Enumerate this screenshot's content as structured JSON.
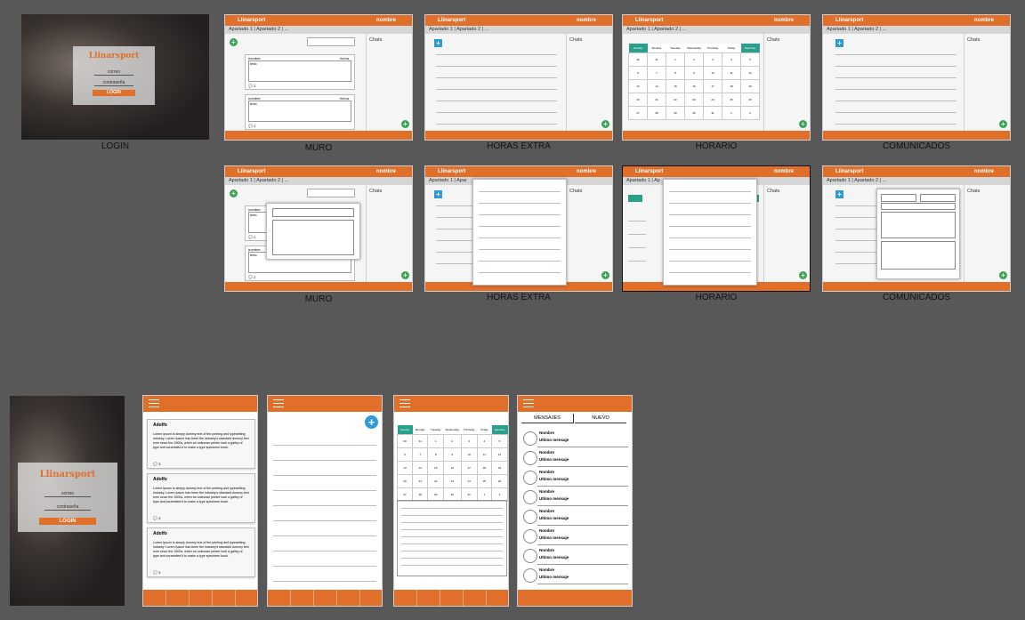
{
  "brand": "Llinarsport",
  "user_name": "nombre",
  "breadcrumb": "Apartado 1 | Apartado 2 | ...",
  "breadcrumb_cut": "Apartado 1 | Apar",
  "breadcrumb_cut2": "Apartado 1 | Ap",
  "chats_label": "Chats",
  "login": {
    "user_field": "correo",
    "password_field": "contraseña",
    "button": "LOGIN"
  },
  "captions": {
    "login": "LOGIN",
    "muro": "MURO",
    "horas_extra": "HORAS EXTRA",
    "horario": "HORARIO",
    "comunicados": "COMUNICADOS"
  },
  "post": {
    "author_label": "nombre",
    "date_label": "fecha",
    "body_label": "texto",
    "comments": "2"
  },
  "calendar": {
    "weekdays": [
      "Sunday",
      "Monday",
      "Tuesday",
      "Wednesday",
      "Thursday",
      "Friday",
      "Saturday"
    ],
    "rows": [
      [
        "30",
        "31",
        "1",
        "2",
        "3",
        "4",
        "5"
      ],
      [
        "6",
        "7",
        "8",
        "9",
        "10",
        "11",
        "12"
      ],
      [
        "13",
        "14",
        "15",
        "16",
        "17",
        "18",
        "19"
      ],
      [
        "20",
        "21",
        "22",
        "23",
        "24",
        "25",
        "26"
      ],
      [
        "27",
        "28",
        "29",
        "30",
        "31",
        "1",
        "2"
      ]
    ]
  },
  "mobile_posts": [
    {
      "author": "Adolfo",
      "text": "Lorem Ipsum is simply dummy text of the printing and typesetting industry. Lorem Ipsum has been the industry's standard dummy text ever since the 1500s, when an unknown printer took a galley of type and scrambled it to make a type specimen book.",
      "comments": "3"
    },
    {
      "author": "Adolfo",
      "text": "Lorem Ipsum is simply dummy text of the printing and typesetting industry. Lorem Ipsum has been the industry's standard dummy text ever since the 1500s, when an unknown printer took a galley of type and scrambled it to make a type specimen book.",
      "comments": "3"
    },
    {
      "author": "Adolfo",
      "text": "Lorem Ipsum is simply dummy text of the printing and typesetting industry. Lorem Ipsum has been the industry's standard dummy text ever since the 1500s, when an unknown printer took a galley of type and scrambled it to make a type specimen book.",
      "comments": "3"
    }
  ],
  "messages_tabs": {
    "left": "MENSAJES",
    "right": "NUEVO"
  },
  "chat_item": {
    "name": "Nombre",
    "last": "Ultimo mensaje"
  },
  "colors": {
    "brand_orange": "#e06f2a",
    "accent_green": "#3aa456",
    "accent_blue": "#2b9ad6",
    "calendar_teal": "#29a08a",
    "board_bg": "#585858"
  }
}
